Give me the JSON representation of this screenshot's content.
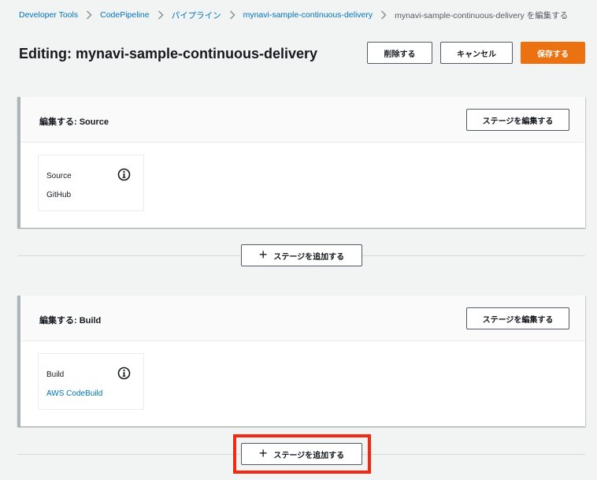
{
  "breadcrumb": {
    "items": [
      {
        "label": "Developer Tools"
      },
      {
        "label": "CodePipeline"
      },
      {
        "label": "パイプライン"
      },
      {
        "label": "mynavi-sample-continuous-delivery"
      }
    ],
    "current": "mynavi-sample-continuous-delivery を編集する"
  },
  "header": {
    "title": "Editing: mynavi-sample-continuous-delivery",
    "delete_label": "削除する",
    "cancel_label": "キャンセル",
    "save_label": "保存する"
  },
  "stages": [
    {
      "title": "編集する: Source",
      "edit_label": "ステージを編集する",
      "action": {
        "name": "Source",
        "provider": "GitHub"
      }
    },
    {
      "title": "編集する: Build",
      "edit_label": "ステージを編集する",
      "action": {
        "name": "Build",
        "provider": "AWS CodeBuild"
      }
    }
  ],
  "add_stage_label": "ステージを追加する",
  "colors": {
    "primary": "#ec7211",
    "link": "#0073bb",
    "highlight": "#f12914",
    "background": "#f2f3f3"
  }
}
